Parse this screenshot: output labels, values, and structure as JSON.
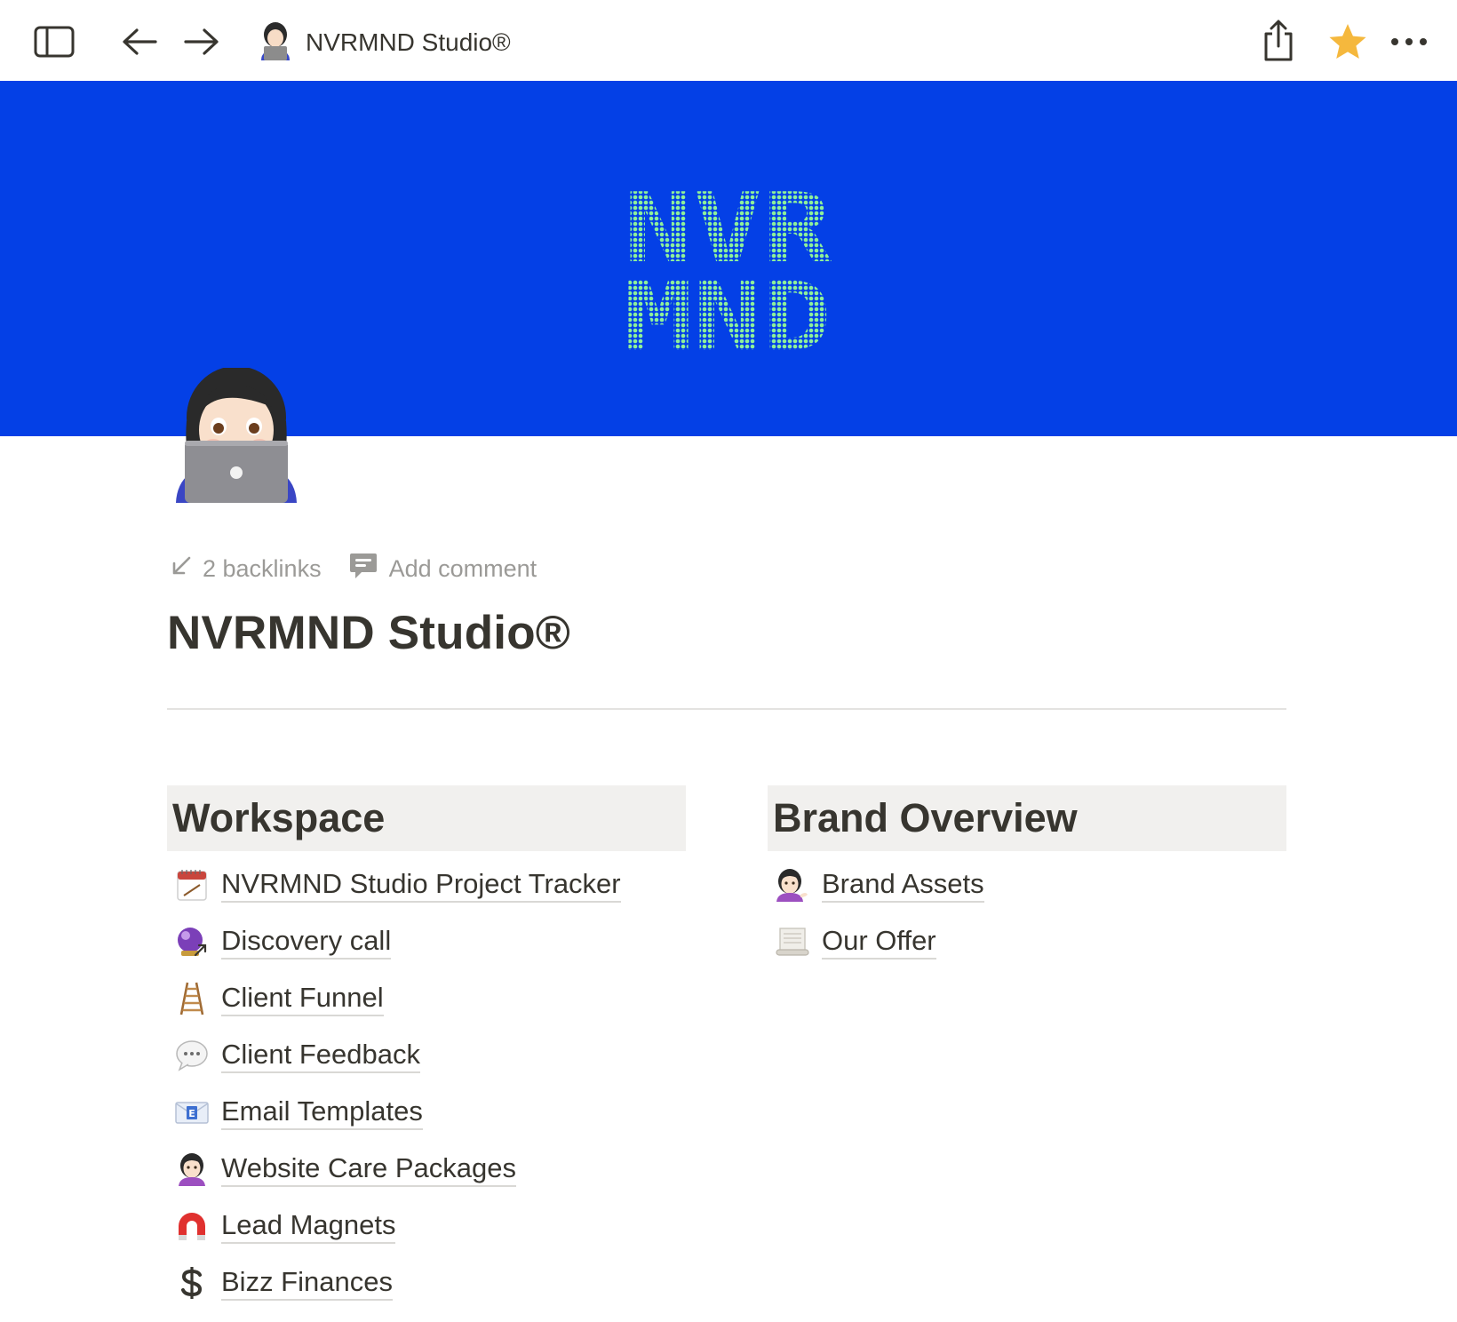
{
  "topbar": {
    "title": "NVRMND Studio®",
    "sidebar_toggle_icon": "sidebar-icon",
    "back_icon": "arrow-left-icon",
    "forward_icon": "arrow-right-icon",
    "share_icon": "share-icon",
    "favorite_icon": "star-icon",
    "more_icon": "more-horizontal-icon",
    "star_color": "#f5b83d"
  },
  "cover": {
    "background": "#0440e6",
    "logo_line1": "NVR",
    "logo_line2": "MND",
    "logo_color": "#8ef09a"
  },
  "page_icon": "woman-with-laptop-icon",
  "meta": {
    "backlinks": "2 backlinks",
    "comment": "Add comment"
  },
  "title": "NVRMND Studio®",
  "workspace": {
    "heading": "Workspace",
    "items": [
      {
        "label": "NVRMND Studio Project Tracker",
        "icon": "calendar-icon"
      },
      {
        "label": "Discovery call",
        "icon": "crystal-ball-icon"
      },
      {
        "label": "Client Funnel",
        "icon": "ladder-icon"
      },
      {
        "label": "Client Feedback",
        "icon": "speech-bubble-icon"
      },
      {
        "label": "Email Templates",
        "icon": "email-icon"
      },
      {
        "label": "Website Care Packages",
        "icon": "woman-icon"
      },
      {
        "label": "Lead Magnets",
        "icon": "magnet-icon"
      },
      {
        "label": "Bizz Finances",
        "icon": "dollar-icon"
      }
    ]
  },
  "brand": {
    "heading": "Brand Overview",
    "items": [
      {
        "label": "Brand Assets",
        "icon": "woman-tipping-hand-icon"
      },
      {
        "label": "Our Offer",
        "icon": "scroll-icon"
      }
    ]
  }
}
